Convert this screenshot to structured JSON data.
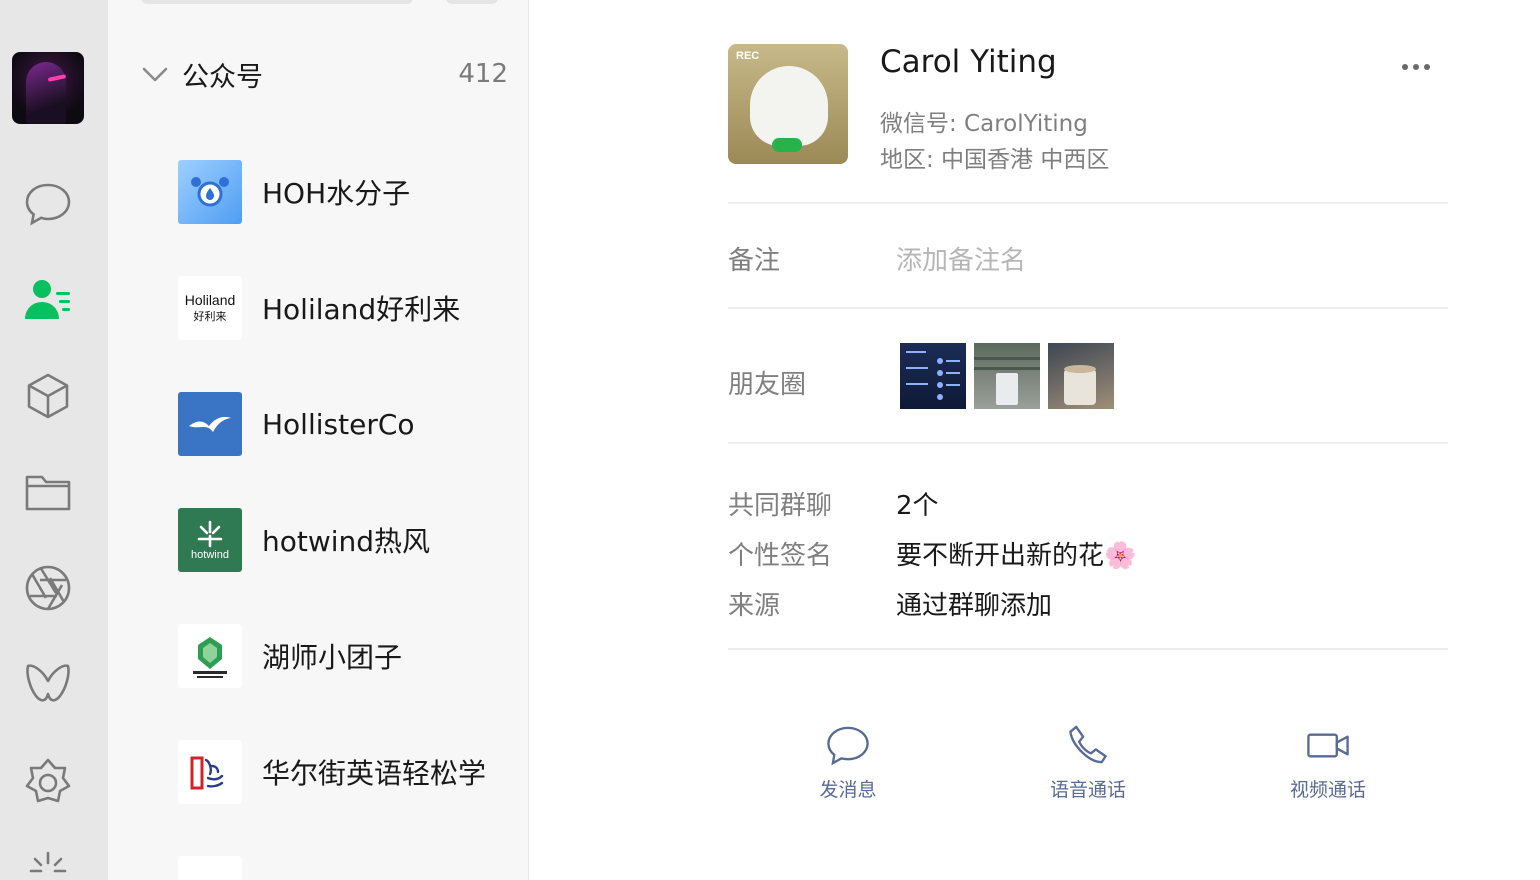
{
  "sidebar": {
    "icons": [
      "chat-bubble-icon",
      "contacts-icon",
      "cube-icon",
      "folder-icon",
      "aperture-icon",
      "butterfly-icon",
      "flower-hexagon-icon",
      "sparkle-icon"
    ],
    "accent": "#07c160"
  },
  "contact_list": {
    "section": {
      "title": "公众号",
      "count": "412"
    },
    "items": [
      {
        "name": "HOH水分子",
        "icon": "water-drop-logo"
      },
      {
        "name": "Holiland好利来",
        "icon": "holiland-logo",
        "logo_line1": "Holiland",
        "logo_line2": "好利来"
      },
      {
        "name": "HollisterCo",
        "icon": "seagull-logo"
      },
      {
        "name": "hotwind热风",
        "icon": "hotwind-logo",
        "logo_text": "hotwind"
      },
      {
        "name": "湖师小团子",
        "icon": "green-emblem-logo"
      },
      {
        "name": "华尔街英语轻松学",
        "icon": "wall-street-english-logo"
      }
    ]
  },
  "profile": {
    "name": "Carol Yiting",
    "wechat_id": "微信号: CarolYiting",
    "region": "地区: 中国香港 中西区",
    "avatar_text": "REC",
    "remark_label": "备注",
    "remark_placeholder": "添加备注名",
    "moments_label": "朋友圈",
    "rows": [
      {
        "label": "共同群聊",
        "value": "2个"
      },
      {
        "label": "个性签名",
        "value": "要不断开出新的花🌸"
      },
      {
        "label": "来源",
        "value": "通过群聊添加"
      }
    ],
    "actions": [
      {
        "label": "发消息",
        "icon": "chat-bubble-icon"
      },
      {
        "label": "语音通话",
        "icon": "phone-icon"
      },
      {
        "label": "视频通话",
        "icon": "video-camera-icon"
      }
    ],
    "link_color": "#576b95"
  }
}
